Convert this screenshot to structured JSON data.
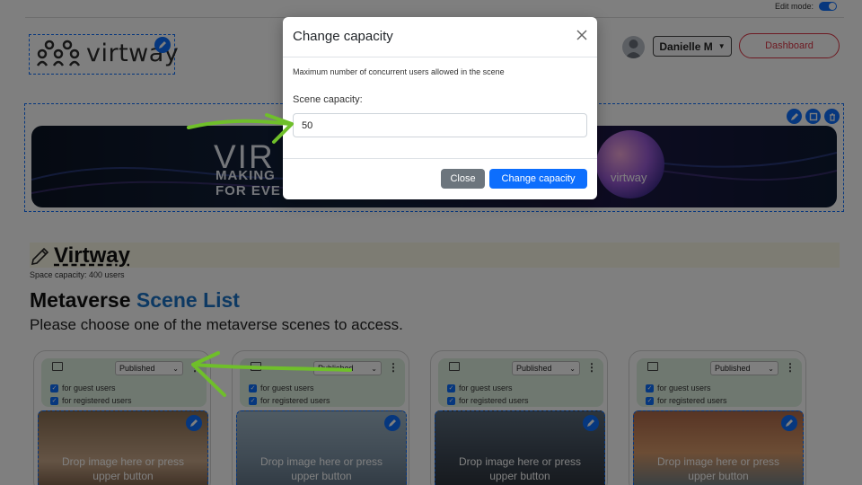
{
  "topbar": {
    "edit_mode_label": "Edit mode:"
  },
  "logo": {
    "text": "virtway"
  },
  "header": {
    "user_label": "Danielle M",
    "dashboard_label": "Dashboard"
  },
  "banner": {
    "title": "VIR",
    "line1": "MAKING",
    "line2": "FOR EVE",
    "orb_text": "virtway"
  },
  "space": {
    "title": "Virtway",
    "capacity": "Space capacity: 400 users"
  },
  "scene_list": {
    "title_main": "Metaverse ",
    "title_accent": "Scene List",
    "subtitle": "Please choose one of the metaverse scenes to access."
  },
  "cards": [
    {
      "status": "Published",
      "guest": "for guest users",
      "registered": "for registered users",
      "drop_line1": "Drop image here or press",
      "drop_line2": "upper button"
    },
    {
      "status": "Published",
      "guest": "for guest users",
      "registered": "for registered users",
      "drop_line1": "Drop image here or press",
      "drop_line2": "upper button"
    },
    {
      "status": "Published",
      "guest": "for guest users",
      "registered": "for registered users",
      "drop_line1": "Drop image here or press",
      "drop_line2": "upper button"
    },
    {
      "status": "Published",
      "guest": "for guest users",
      "registered": "for registered users",
      "drop_line1": "Drop image here or press",
      "drop_line2": "upper button"
    }
  ],
  "modal": {
    "title": "Change capacity",
    "description": "Maximum number of concurrent users allowed in the scene",
    "field_label": "Scene capacity:",
    "field_value": "50",
    "close_label": "Close",
    "submit_label": "Change capacity"
  },
  "colors": {
    "accent": "#0d6efd",
    "danger": "#dc3545",
    "annotation_arrow": "#6fbf2a"
  }
}
